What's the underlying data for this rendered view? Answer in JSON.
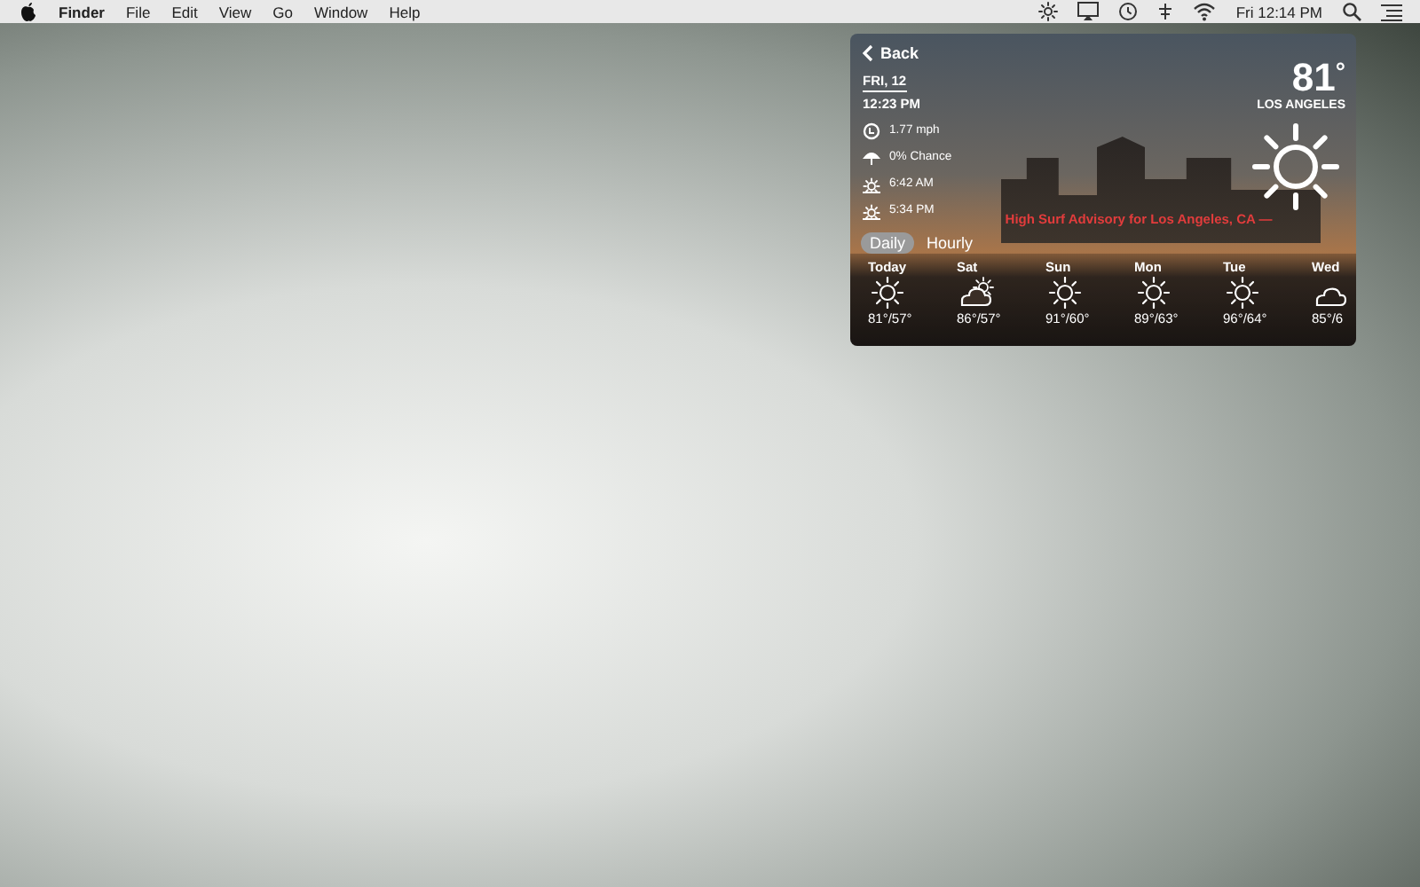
{
  "menu_bar": {
    "app": "Finder",
    "menus": [
      "File",
      "Edit",
      "View",
      "Go",
      "Window",
      "Help"
    ],
    "clock": "Fri 12:14 PM"
  },
  "weather": {
    "back": "Back",
    "date": "FRI, 12",
    "time": "12:23 PM",
    "temperature": "81",
    "degree": "°",
    "city": "LOS ANGELES",
    "stats": [
      {
        "kind": "wind",
        "text": "1.77 mph"
      },
      {
        "kind": "rain",
        "text": "0% Chance"
      },
      {
        "kind": "sunrise",
        "text": "6:42 AM"
      },
      {
        "kind": "sunset",
        "text": "5:34 PM"
      }
    ],
    "advisory": "High Surf Advisory for Los Angeles, CA —",
    "tabs": [
      {
        "label": "Daily",
        "selected": true
      },
      {
        "label": "Hourly",
        "selected": false
      }
    ],
    "forecast": [
      {
        "day": "Today",
        "kind": "sun",
        "temps": "81°/57°"
      },
      {
        "day": "Sat",
        "kind": "partly-cloudy",
        "temps": "86°/57°"
      },
      {
        "day": "Sun",
        "kind": "sun",
        "temps": "91°/60°"
      },
      {
        "day": "Mon",
        "kind": "sun",
        "temps": "89°/63°"
      },
      {
        "day": "Tue",
        "kind": "sun",
        "temps": "96°/64°"
      },
      {
        "day": "Wed",
        "kind": "cloud",
        "temps": "85°/6"
      }
    ]
  }
}
